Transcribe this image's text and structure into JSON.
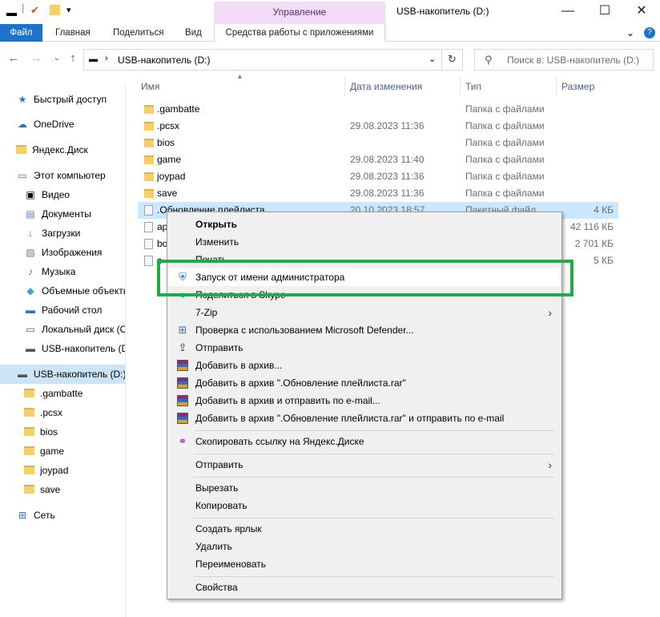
{
  "titlebar": {
    "manage_label": "Управление",
    "window_title": "USB-накопитель (D:)",
    "minimize": "—",
    "maximize": "☐",
    "close": "✕"
  },
  "ribbon": {
    "tabs": [
      "Файл",
      "Главная",
      "Поделиться",
      "Вид",
      "Средства работы с приложениями"
    ],
    "collapse": "⌄",
    "help": "?"
  },
  "address": {
    "path": "USB-накопитель (D:)",
    "search_placeholder": "Поиск в: USB-накопитель (D:)"
  },
  "nav": {
    "items": [
      {
        "label": "Быстрый доступ",
        "icon": "star-icon"
      },
      {
        "label": "OneDrive",
        "icon": "cloud-icon"
      },
      {
        "label": "Яндекс.Диск",
        "icon": "folder-icon"
      },
      {
        "label": "Этот компьютер",
        "icon": "computer-icon"
      },
      {
        "label": "Видео",
        "icon": "video-icon"
      },
      {
        "label": "Документы",
        "icon": "documents-icon"
      },
      {
        "label": "Загрузки",
        "icon": "download-icon"
      },
      {
        "label": "Изображения",
        "icon": "pictures-icon"
      },
      {
        "label": "Музыка",
        "icon": "music-icon"
      },
      {
        "label": "Объемные объекты",
        "icon": "3d-icon"
      },
      {
        "label": "Рабочий стол",
        "icon": "desktop-icon"
      },
      {
        "label": "Локальный диск (C:)",
        "icon": "drive-icon"
      },
      {
        "label": "USB-накопитель (D:)",
        "icon": "usb-drive-icon"
      },
      {
        "label": "USB-накопитель (D:)",
        "icon": "usb-drive-icon"
      },
      {
        "label": ".gambatte",
        "icon": "folder-icon"
      },
      {
        "label": ".pcsx",
        "icon": "folder-icon"
      },
      {
        "label": "bios",
        "icon": "folder-icon"
      },
      {
        "label": "game",
        "icon": "folder-icon"
      },
      {
        "label": "joypad",
        "icon": "folder-icon"
      },
      {
        "label": "save",
        "icon": "folder-icon"
      },
      {
        "label": "Сеть",
        "icon": "network-icon"
      }
    ]
  },
  "columns": {
    "name": "Имя",
    "date": "Дата изменения",
    "type": "Тип",
    "size": "Размер"
  },
  "files": [
    {
      "name": ".gambatte",
      "date": "",
      "type": "Папка с файлами",
      "size": ""
    },
    {
      "name": ".pcsx",
      "date": "29.08.2023 11:36",
      "type": "Папка с файлами",
      "size": ""
    },
    {
      "name": "bios",
      "date": "",
      "type": "Папка с файлами",
      "size": ""
    },
    {
      "name": "game",
      "date": "29.08.2023 11:40",
      "type": "Папка с файлами",
      "size": ""
    },
    {
      "name": "joypad",
      "date": "29.08.2023 11:36",
      "type": "Папка с файлами",
      "size": ""
    },
    {
      "name": "save",
      "date": "29.08.2023 11:36",
      "type": "Папка с файлами",
      "size": ""
    },
    {
      "name": ".Обновление плейлиста",
      "date": "20.10.2023 18:57",
      "type": "Пакетный файл",
      "size": "4 КБ"
    },
    {
      "name": "ap",
      "date": "",
      "type": "",
      "size": "42 116 КБ"
    },
    {
      "name": "bo",
      "date": "",
      "type": "",
      "size": "2 701 КБ"
    },
    {
      "name": "c",
      "date": "",
      "type": "",
      "size": "5 КБ"
    }
  ],
  "context_menu": {
    "open": "Открыть",
    "edit": "Изменить",
    "print": "Печать",
    "run_as_admin": "Запуск от имени администратора",
    "share_skype": "Поделиться в Skype",
    "sevenzip": "7-Zip",
    "defender": "Проверка с использованием Microsoft Defender...",
    "send": "Отправить",
    "add_archive": "Добавить в архив...",
    "add_archive_rar": "Добавить в архив \".Обновление плейлиста.rar\"",
    "add_archive_email": "Добавить в архив и отправить по e-mail...",
    "add_archive_rar_email": "Добавить в архив \".Обновление плейлиста.rar\" и отправить по e-mail",
    "yandex_link": "Скопировать ссылку на Яндекс.Диске",
    "send_to": "Отправить",
    "cut": "Вырезать",
    "copy": "Копировать",
    "shortcut": "Создать ярлык",
    "delete": "Удалить",
    "rename": "Переименовать",
    "properties": "Свойства"
  },
  "colors": {
    "highlight_box": "#1fad46",
    "file_tab": "#1e73c7",
    "manage_band": "#f3dcf7"
  }
}
